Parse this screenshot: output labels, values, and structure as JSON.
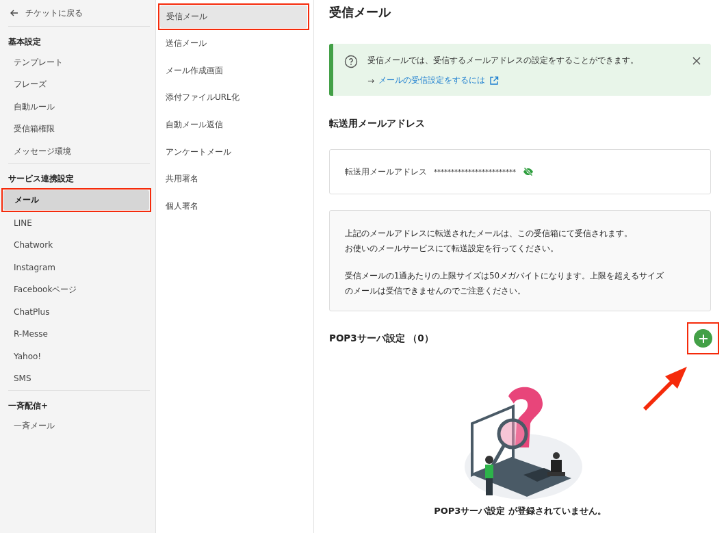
{
  "sidebar": {
    "back_link": "チケットに戻る",
    "sections": [
      {
        "title": "基本設定",
        "items": [
          {
            "label": "テンプレート",
            "selected": false,
            "annotated": false
          },
          {
            "label": "フレーズ",
            "selected": false,
            "annotated": false
          },
          {
            "label": "自動ルール",
            "selected": false,
            "annotated": false
          },
          {
            "label": "受信箱権限",
            "selected": false,
            "annotated": false
          },
          {
            "label": "メッセージ環境",
            "selected": false,
            "annotated": false
          }
        ]
      },
      {
        "title": "サービス連携設定",
        "items": [
          {
            "label": "メール",
            "selected": true,
            "annotated": true
          },
          {
            "label": "LINE",
            "selected": false,
            "annotated": false
          },
          {
            "label": "Chatwork",
            "selected": false,
            "annotated": false
          },
          {
            "label": "Instagram",
            "selected": false,
            "annotated": false
          },
          {
            "label": "Facebookページ",
            "selected": false,
            "annotated": false
          },
          {
            "label": "ChatPlus",
            "selected": false,
            "annotated": false
          },
          {
            "label": "R-Messe",
            "selected": false,
            "annotated": false
          },
          {
            "label": "Yahoo!",
            "selected": false,
            "annotated": false
          },
          {
            "label": "SMS",
            "selected": false,
            "annotated": false
          }
        ]
      },
      {
        "title": "一斉配信+",
        "items": [
          {
            "label": "一斉メール",
            "selected": false,
            "annotated": false
          }
        ]
      }
    ]
  },
  "subnav": {
    "items": [
      {
        "label": "受信メール",
        "selected": true,
        "annotated": true
      },
      {
        "label": "送信メール",
        "selected": false,
        "annotated": false
      },
      {
        "label": "メール作成画面",
        "selected": false,
        "annotated": false
      },
      {
        "label": "添付ファイルURL化",
        "selected": false,
        "annotated": false
      },
      {
        "label": "自動メール返信",
        "selected": false,
        "annotated": false
      },
      {
        "label": "アンケートメール",
        "selected": false,
        "annotated": false
      },
      {
        "label": "共用署名",
        "selected": false,
        "annotated": false
      },
      {
        "label": "個人署名",
        "selected": false,
        "annotated": false
      }
    ]
  },
  "main": {
    "title": "受信メール",
    "info_banner": {
      "text": "受信メールでは、受信するメールアドレスの設定をすることができます。",
      "arrow": "→",
      "link": "メールの受信設定をするには"
    },
    "forward_section": {
      "heading": "転送用メールアドレス",
      "field_label": "転送用メールアドレス",
      "masked_value": "************************"
    },
    "note": {
      "paragraphs": [
        [
          "上記のメールアドレスに転送されたメールは、この受信箱にて受信されます。",
          "お使いのメールサービスにて転送設定を行ってください。"
        ],
        [
          "受信メールの1通あたりの上限サイズは50メガバイトになります。上限を超えるサイズ",
          "のメールは受信できませんのでご注意ください。"
        ]
      ]
    },
    "pop3": {
      "heading": "POP3サーバ設定 （0）",
      "add_annotated": true,
      "empty_message": "POP3サーバ設定 が登録されていません。"
    }
  }
}
